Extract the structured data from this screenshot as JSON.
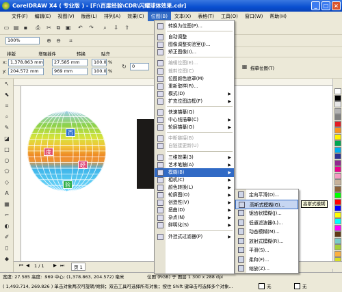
{
  "window": {
    "title": "CorelDRAW X4 ( 专业版 ) - [F:\\百度经验\\CDR\\闪耀球体效果.cdr]"
  },
  "menubar": [
    "文件(F)",
    "编辑(E)",
    "视图(V)",
    "版面(L)",
    "排列(A)",
    "效果(C)",
    "位图(B)",
    "文本(X)",
    "表格(T)",
    "工具(O)",
    "窗口(W)",
    "帮助(H)"
  ],
  "toolbar": {
    "zoom": "100%",
    "plugins": [
      "排版",
      "增强插件",
      "转换",
      "贴齐"
    ],
    "x_label": "x:",
    "x": "1,378.863 mm",
    "y_label": "y:",
    "y": "204.572 mm",
    "w": "27.585 mm",
    "h": "969 mm",
    "scale_w": "100.0",
    "scale_h": "100.0",
    "pct": "%",
    "angle": "0",
    "trace_button": "描摹位图(T)"
  },
  "bitmap_menu": {
    "items": [
      {
        "label": "转换为位图(P)...",
        "disabled": false,
        "submenu": false
      },
      {
        "sep": true
      },
      {
        "label": "自动调整",
        "disabled": false,
        "submenu": false
      },
      {
        "label": "图像调整实验室(J)...",
        "disabled": false,
        "submenu": false
      },
      {
        "label": "矫正图像(I)...",
        "disabled": false,
        "submenu": false
      },
      {
        "sep": true
      },
      {
        "label": "编辑位图(E)...",
        "disabled": true,
        "submenu": false
      },
      {
        "label": "裁剪位图(C)",
        "disabled": true,
        "submenu": false
      },
      {
        "label": "位图颜色遮罩(M)",
        "disabled": false,
        "submenu": false
      },
      {
        "label": "重新取样(R)...",
        "disabled": false,
        "submenu": false
      },
      {
        "label": "模式(D)",
        "disabled": false,
        "submenu": true
      },
      {
        "label": "扩充位图边框(F)",
        "disabled": false,
        "submenu": true
      },
      {
        "sep": true
      },
      {
        "label": "快速描摹(Q)",
        "disabled": false,
        "submenu": false
      },
      {
        "label": "中心线描摹(C)",
        "disabled": false,
        "submenu": true
      },
      {
        "label": "轮廓描摹(O)",
        "disabled": false,
        "submenu": true
      },
      {
        "sep": true
      },
      {
        "label": "中断链接(B)",
        "disabled": true,
        "submenu": false
      },
      {
        "label": "自链接更新(U)",
        "disabled": true,
        "submenu": false
      },
      {
        "sep": true
      },
      {
        "label": "三维效果(3)",
        "disabled": false,
        "submenu": true
      },
      {
        "label": "艺术笔触(A)",
        "disabled": false,
        "submenu": true
      },
      {
        "label": "模糊(B)",
        "disabled": false,
        "submenu": true,
        "highlighted": true
      },
      {
        "label": "相机(C)",
        "disabled": false,
        "submenu": true
      },
      {
        "label": "颜色转换(L)",
        "disabled": false,
        "submenu": true
      },
      {
        "label": "轮廓图(O)",
        "disabled": false,
        "submenu": true
      },
      {
        "label": "创造性(V)",
        "disabled": false,
        "submenu": true
      },
      {
        "label": "扭曲(D)",
        "disabled": false,
        "submenu": true
      },
      {
        "label": "杂点(N)",
        "disabled": false,
        "submenu": true
      },
      {
        "label": "鲜明化(S)",
        "disabled": false,
        "submenu": true
      },
      {
        "sep": true
      },
      {
        "label": "外挂式过滤器(P)",
        "disabled": false,
        "submenu": true
      }
    ]
  },
  "blur_submenu": {
    "items": [
      {
        "label": "定向平滑(D)...",
        "highlighted": false
      },
      {
        "label": "高斯式模糊(G)...",
        "highlighted": true
      },
      {
        "label": "锯齿状模糊(J)...",
        "highlighted": false
      },
      {
        "label": "低通滤波器(L)...",
        "highlighted": false
      },
      {
        "label": "动态模糊(M)...",
        "highlighted": false
      },
      {
        "label": "放射式模糊(R)...",
        "highlighted": false
      },
      {
        "label": "平滑(S)...",
        "highlighted": false
      },
      {
        "label": "柔和(F)...",
        "highlighted": false
      },
      {
        "label": "缩放(Z)...",
        "highlighted": false
      }
    ]
  },
  "tooltip": "高斯式模糊",
  "sphere_chips": [
    {
      "text": "百",
      "color": "#2b6fd1"
    },
    {
      "text": "度",
      "color": "#e0506e"
    },
    {
      "text": "经",
      "color": "#e0507e"
    },
    {
      "text": "验",
      "color": "#2fae4a"
    }
  ],
  "pagebar": {
    "counter": "1 / 1",
    "page_tab": "页 1"
  },
  "status": {
    "line1": "宽度: 27.585 高度: .969  中心: (1,378.863, 204.572) 毫米",
    "line1_right": "位图 (RGB) 于 图层 1 300 x 288 dpi",
    "line2": "( 1,493.714, 269.826 )  单击对象两次可旋转/倾斜；双击工具可选择所有对象；按住 Shift 键单击可选择多个对象...",
    "fill_none": "无",
    "outline_none": "无"
  },
  "palette": [
    "#ffffff",
    "#000000",
    "#e6e6e6",
    "#b3b3b3",
    "#808080",
    "#e31c23",
    "#f7931e",
    "#fff200",
    "#00a651",
    "#00aeef",
    "#2e3192",
    "#92278f",
    "#ec008c",
    "#f49ac1",
    "#c7b299",
    "#8c6239",
    "#00ff00",
    "#ff0000",
    "#0000ff",
    "#ffff00",
    "#00ffff",
    "#ff00ff",
    "#603913",
    "#7accc8",
    "#a6ce39",
    "#fbb040",
    "#d7df23"
  ]
}
